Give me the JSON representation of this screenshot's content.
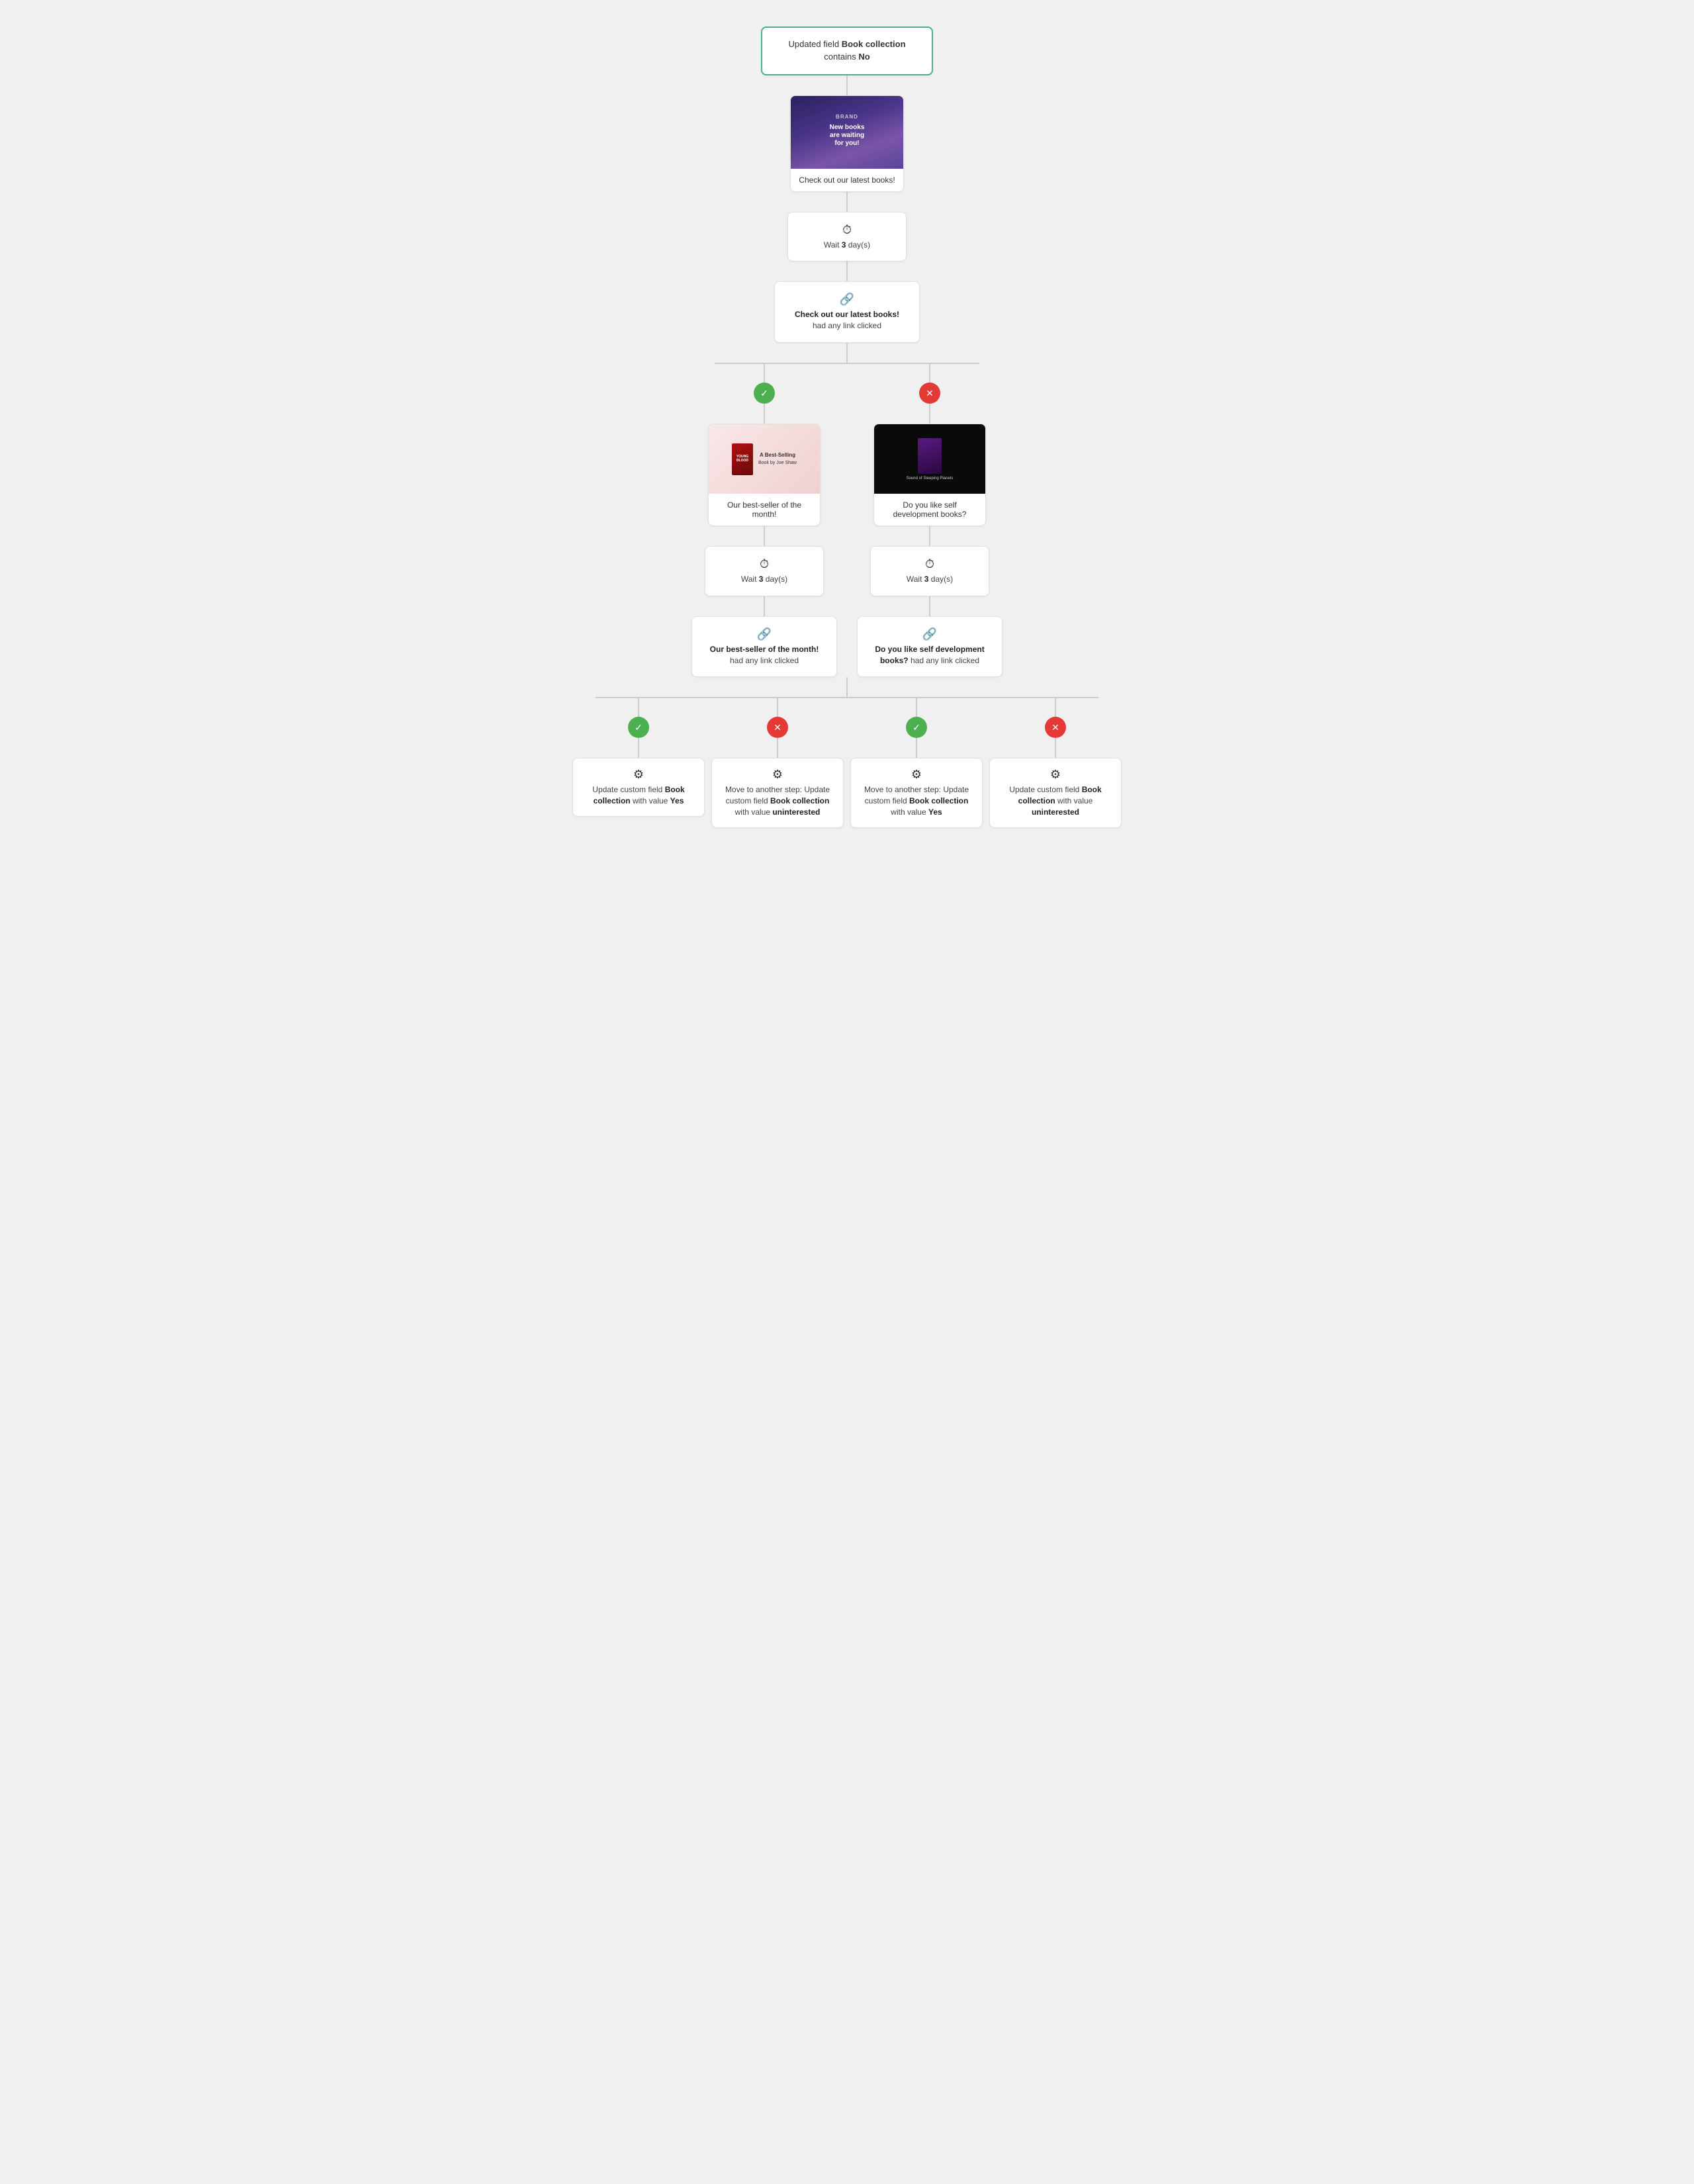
{
  "trigger": {
    "text_pre": "Updated field ",
    "field_name": "Book collection",
    "text_mid": " contains ",
    "value": "No"
  },
  "email1": {
    "label": "Check out our latest books!",
    "thumb_line1": "New books",
    "thumb_line2": "are waiting",
    "thumb_line3": "for you!"
  },
  "wait1": {
    "label_pre": "Wait ",
    "days": "3",
    "label_post": " day(s)"
  },
  "condition1": {
    "email_name": "Check out our latest books!",
    "condition": "had any link clicked"
  },
  "badge_yes": "✓",
  "badge_no": "✕",
  "email2": {
    "label": "Our best-seller of the month!",
    "book_title": "YOUNG BLOOD"
  },
  "email3": {
    "label": "Do you like self development books?",
    "book_title": "SOUND OF SLEEPING PLANETS"
  },
  "wait2": {
    "label_pre": "Wait ",
    "days": "3",
    "label_post": " day(s)"
  },
  "wait3": {
    "label_pre": "Wait ",
    "days": "3",
    "label_post": " day(s)"
  },
  "condition2": {
    "email_name": "Our best-seller of the month!",
    "condition": "had any link clicked"
  },
  "condition3": {
    "email_name": "Do you like self development books?",
    "condition": "had any link clicked"
  },
  "action1": {
    "label_pre": "Update custom field ",
    "field": "Book collection",
    "label_mid": " with value ",
    "value": "Yes"
  },
  "action2": {
    "label_pre": "Move to another step: Update custom field ",
    "field": "Book collection",
    "label_mid": " with value ",
    "value": "uninterested"
  },
  "action3": {
    "label_pre": "Move to another step: Update custom field ",
    "field": "Book collection",
    "label_mid": " with value ",
    "value": "Yes"
  },
  "action4": {
    "label_pre": "Update custom field ",
    "field": "Book collection",
    "label_mid": " with value ",
    "value": "uninterested"
  }
}
